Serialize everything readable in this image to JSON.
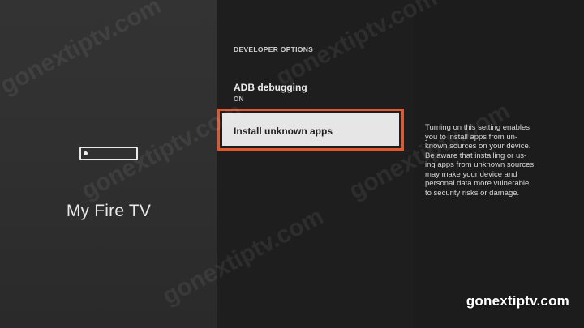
{
  "left_panel": {
    "title": "My Fire TV",
    "device_icon": "fire-tv-device-icon"
  },
  "middle_panel": {
    "section_header": "DEVELOPER OPTIONS",
    "items": [
      {
        "label": "ADB debugging",
        "value": "ON"
      },
      {
        "label": "Install unknown apps",
        "focused": true
      }
    ],
    "focus_color": "#e2582e"
  },
  "right_panel": {
    "description_lines": [
      "Turning on this setting enables",
      "you to install apps from un-",
      "known sources on your device.",
      "Be aware that installing or us-",
      "ing apps from unknown sources",
      "may make your device and",
      "personal data more vulnerable",
      "to security risks or damage."
    ]
  },
  "watermark": {
    "text": "gonextiptv.com",
    "brand_label": "gonextiptv.com"
  }
}
